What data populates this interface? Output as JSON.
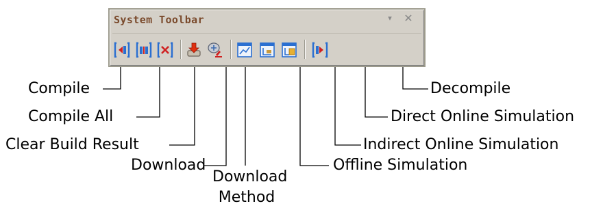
{
  "toolbar": {
    "title": "System Toolbar",
    "dropdown_glyph": "▾",
    "close_glyph": "✕",
    "buttons": [
      {
        "icon": "compile-icon",
        "callout": "Compile"
      },
      {
        "icon": "compile-all-icon",
        "callout": "Compile All"
      },
      {
        "icon": "clear-build-result-icon",
        "callout": "Clear Build Result"
      },
      {
        "icon": "download-icon",
        "callout": "Download"
      },
      {
        "icon": "download-method-icon",
        "callout": "Download Method",
        "callout_lines": [
          "Download",
          "Method"
        ]
      },
      {
        "icon": "offline-simulation-icon",
        "callout": "Offline Simulation"
      },
      {
        "icon": "indirect-online-simulation-icon",
        "callout": "Indirect Online Simulation"
      },
      {
        "icon": "direct-online-simulation-icon",
        "callout": "Direct Online Simulation"
      },
      {
        "icon": "decompile-icon",
        "callout": "Decompile"
      }
    ]
  },
  "colors": {
    "toolbar_bg": "#d4d0c8",
    "title_text": "#7a4a2c",
    "icon_blue": "#2a6fd1",
    "icon_red": "#d02020",
    "leader_line": "#000000"
  }
}
